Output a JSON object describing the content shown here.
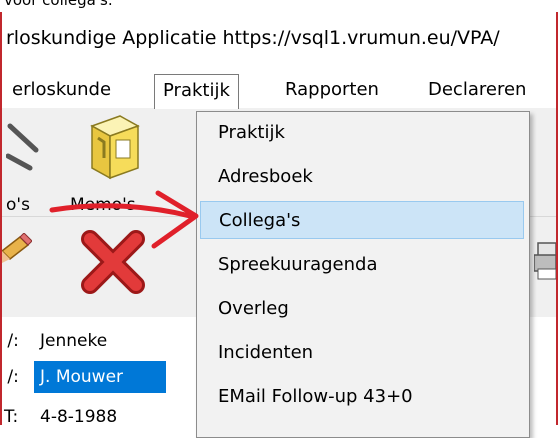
{
  "caption": "voor collega's:",
  "window": {
    "title": "rloskundige Applicatie https://vsql1.vrumun.eu/VPA/"
  },
  "menubar": {
    "items": [
      {
        "label": "erloskunde"
      },
      {
        "label": "Praktijk"
      },
      {
        "label": "Rapporten"
      },
      {
        "label": "Declareren"
      }
    ]
  },
  "toolbar": {
    "buttons": [
      {
        "label": "o's",
        "icon": "photos-icon"
      },
      {
        "label": "Memo's",
        "icon": "memo-icon"
      }
    ]
  },
  "form": {
    "rows": [
      {
        "prefix": " /:",
        "value": "Jenneke"
      },
      {
        "prefix": " /:",
        "value": "J. Mouwer"
      },
      {
        "prefix": "T:",
        "value": "4-8-1988"
      }
    ]
  },
  "dropdown": {
    "items": [
      {
        "label": "Praktijk"
      },
      {
        "label": "Adresboek"
      },
      {
        "label": "Collega's"
      },
      {
        "label": "Spreekuuragenda"
      },
      {
        "label": "Overleg"
      },
      {
        "label": "Incidenten"
      },
      {
        "label": "EMail Follow-up 43+0"
      }
    ],
    "highlighted_index": 2
  },
  "colors": {
    "window_border": "#c1272d",
    "selection": "#0078d7",
    "menu_highlight": "#cce4f7",
    "annotation_arrow": "#e0202a"
  }
}
